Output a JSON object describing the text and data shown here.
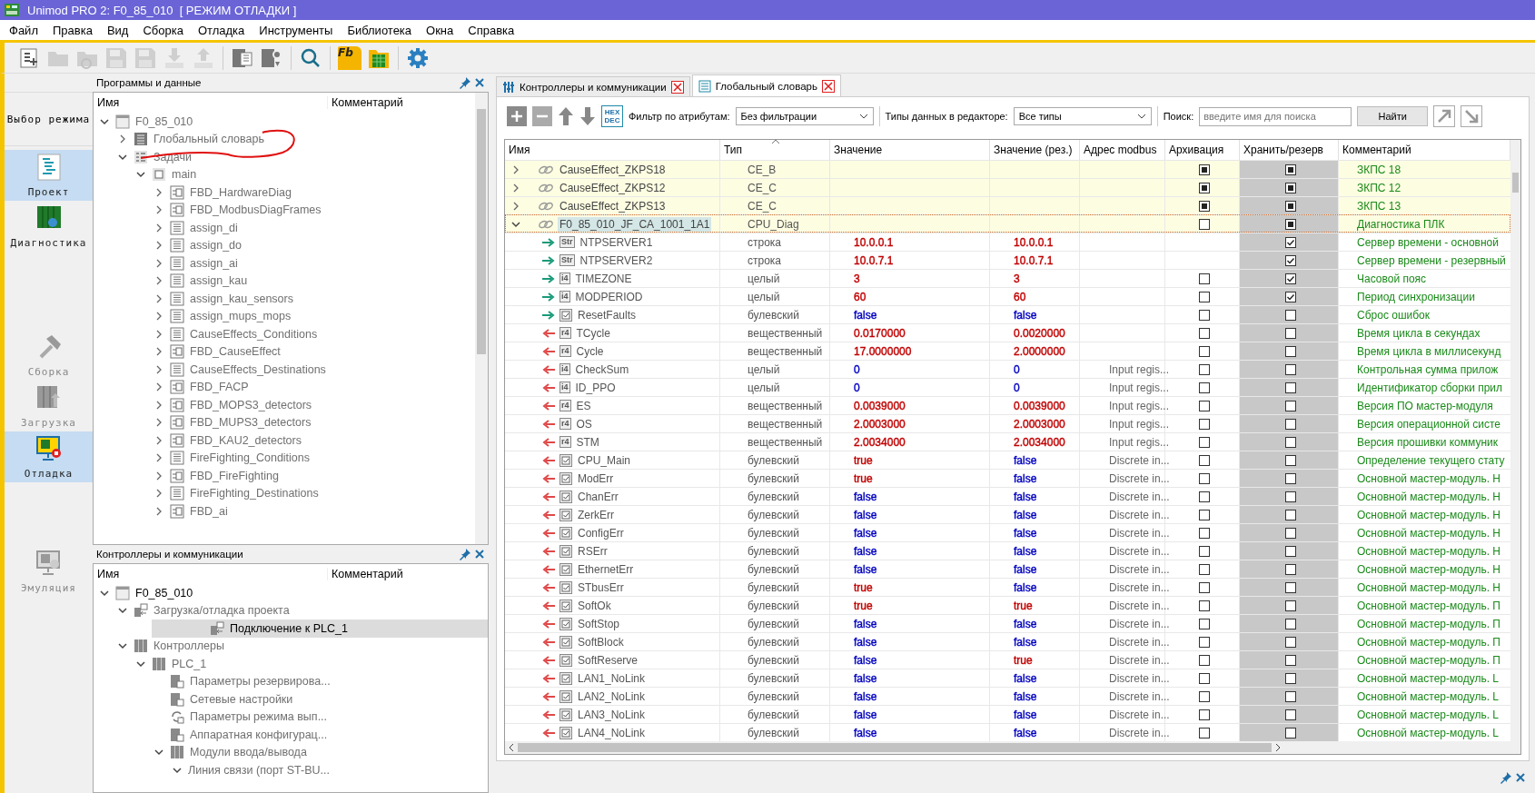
{
  "window": {
    "title": "Unimod PRO 2: F0_85_010  [ РЕЖИМ ОТЛАДКИ ]"
  },
  "menu": [
    "Файл",
    "Правка",
    "Вид",
    "Сборка",
    "Отладка",
    "Инструменты",
    "Библиотека",
    "Окна",
    "Справка"
  ],
  "toolbar": [
    {
      "kind": "new",
      "disabled": false
    },
    {
      "kind": "open",
      "disabled": true
    },
    {
      "kind": "reload",
      "disabled": true
    },
    {
      "kind": "save",
      "disabled": true
    },
    {
      "kind": "save",
      "disabled": true
    },
    {
      "kind": "download",
      "disabled": true
    },
    {
      "kind": "upload",
      "disabled": true
    },
    {
      "kind": "doc",
      "disabled": false
    },
    {
      "kind": "docgear",
      "disabled": false
    },
    {
      "kind": "search",
      "disabled": false
    },
    {
      "kind": "fb",
      "label": "Fb",
      "disabled": false
    },
    {
      "kind": "table",
      "disabled": false
    },
    {
      "kind": "gear",
      "disabled": false
    }
  ],
  "modes": {
    "header": "Выбор режима",
    "items": [
      {
        "kind": "project",
        "label": "Проект",
        "selected": true,
        "disabled": false
      },
      {
        "kind": "diagnostics",
        "label": "Диагностика",
        "selected": false,
        "disabled": false
      },
      {
        "kind": "build",
        "label": "Сборка",
        "selected": false,
        "disabled": true
      },
      {
        "kind": "load",
        "label": "Загрузка",
        "selected": false,
        "disabled": true
      },
      {
        "kind": "debug",
        "label": "Отладка",
        "selected": true,
        "disabled": false
      },
      {
        "kind": "emulation",
        "label": "Эмуляция",
        "selected": false,
        "disabled": true
      }
    ]
  },
  "programs_pane": {
    "title": "Программы и данные",
    "columns": [
      "Имя",
      "Комментарий"
    ],
    "tree": [
      {
        "label": "F0_85_010",
        "kind": "project",
        "expanded": true,
        "dimmed": true,
        "selected": false,
        "children": [
          {
            "label": "Глобальный словарь",
            "kind": "dictionary",
            "expanded": false,
            "dimmed": true,
            "selected": false
          },
          {
            "label": "Задачи",
            "kind": "tasks",
            "expanded": true,
            "dimmed": true,
            "selected": false,
            "children": [
              {
                "label": "main",
                "kind": "task",
                "expanded": true,
                "dimmed": true,
                "selected": false,
                "children": [
                  {
                    "label": "FBD_HardwareDiag",
                    "kind": "fbd",
                    "expanded": false,
                    "dimmed": true,
                    "selected": false
                  },
                  {
                    "label": "FBD_ModbusDiagFrames",
                    "kind": "fbd",
                    "expanded": false,
                    "dimmed": true,
                    "selected": false
                  },
                  {
                    "label": "assign_di",
                    "kind": "st",
                    "expanded": false,
                    "dimmed": true,
                    "selected": false
                  },
                  {
                    "label": "assign_do",
                    "kind": "st",
                    "expanded": false,
                    "dimmed": true,
                    "selected": false
                  },
                  {
                    "label": "assign_ai",
                    "kind": "st",
                    "expanded": false,
                    "dimmed": true,
                    "selected": false
                  },
                  {
                    "label": "assign_kau",
                    "kind": "st",
                    "expanded": false,
                    "dimmed": true,
                    "selected": false
                  },
                  {
                    "label": "assign_kau_sensors",
                    "kind": "st",
                    "expanded": false,
                    "dimmed": true,
                    "selected": false
                  },
                  {
                    "label": "assign_mups_mops",
                    "kind": "st",
                    "expanded": false,
                    "dimmed": true,
                    "selected": false
                  },
                  {
                    "label": "CauseEffects_Conditions",
                    "kind": "st",
                    "expanded": false,
                    "dimmed": true,
                    "selected": false
                  },
                  {
                    "label": "FBD_CauseEffect",
                    "kind": "fbd",
                    "expanded": false,
                    "dimmed": true,
                    "selected": false
                  },
                  {
                    "label": "CauseEffects_Destinations",
                    "kind": "st",
                    "expanded": false,
                    "dimmed": true,
                    "selected": false
                  },
                  {
                    "label": "FBD_FACP",
                    "kind": "fbd",
                    "expanded": false,
                    "dimmed": true,
                    "selected": false
                  },
                  {
                    "label": "FBD_MOPS3_detectors",
                    "kind": "fbd",
                    "expanded": false,
                    "dimmed": true,
                    "selected": false
                  },
                  {
                    "label": "FBD_MUPS3_detectors",
                    "kind": "fbd",
                    "expanded": false,
                    "dimmed": true,
                    "selected": false
                  },
                  {
                    "label": "FBD_KAU2_detectors",
                    "kind": "fbd",
                    "expanded": false,
                    "dimmed": true,
                    "selected": false
                  },
                  {
                    "label": "FireFighting_Conditions",
                    "kind": "st",
                    "expanded": false,
                    "dimmed": true,
                    "selected": false
                  },
                  {
                    "label": "FBD_FireFighting",
                    "kind": "fbd",
                    "expanded": false,
                    "dimmed": true,
                    "selected": false
                  },
                  {
                    "label": "FireFighting_Destinations",
                    "kind": "st",
                    "expanded": false,
                    "dimmed": true,
                    "selected": false
                  },
                  {
                    "label": "FBD_ai",
                    "kind": "fbd",
                    "expanded": false,
                    "dimmed": true,
                    "selected": false
                  }
                ]
              }
            ]
          }
        ]
      }
    ]
  },
  "controllers_pane": {
    "title": "Контроллеры и коммуникации",
    "columns": [
      "Имя",
      "Комментарий"
    ],
    "tree": [
      {
        "label": "F0_85_010",
        "kind": "project",
        "expanded": true,
        "dimmed": false,
        "selected": false,
        "children": [
          {
            "label": "Загрузка/отладка проекта",
            "kind": "connection",
            "expanded": true,
            "dimmed": true,
            "selected": false,
            "children": [
              {
                "label": "Подключение к PLC_1",
                "kind": "connection",
                "dimmed": false,
                "selected": true
              }
            ]
          },
          {
            "label": "Контроллеры",
            "kind": "rack",
            "expanded": true,
            "dimmed": true,
            "selected": false,
            "children": [
              {
                "label": "PLC_1",
                "kind": "rack",
                "expanded": true,
                "dimmed": true,
                "selected": false,
                "children": [
                  {
                    "label": "Параметры резервирова...",
                    "kind": "settings",
                    "dimmed": true,
                    "selected": false
                  },
                  {
                    "label": "Сетевые настройки",
                    "kind": "settings",
                    "dimmed": true,
                    "selected": false
                  },
                  {
                    "label": "Параметры режима вып...",
                    "kind": "cycle",
                    "dimmed": true,
                    "selected": false
                  },
                  {
                    "label": "Аппаратная конфигурац...",
                    "kind": "settings",
                    "dimmed": true,
                    "selected": false
                  },
                  {
                    "label": "Модули ввода/вывода",
                    "kind": "rack",
                    "expanded": true,
                    "dimmed": true,
                    "selected": false,
                    "children": [
                      {
                        "label": "Линия связи (порт ST-BU...",
                        "expanded": true,
                        "dimmed": true,
                        "selected": false
                      }
                    ]
                  }
                ]
              }
            ]
          }
        ]
      }
    ]
  },
  "editor_tabs": [
    {
      "label": "Контроллеры и коммуникации",
      "kind": "controllers",
      "selected": false
    },
    {
      "label": "Глобальный словарь",
      "kind": "dictionary",
      "selected": true
    }
  ],
  "editor_toolbar": {
    "hex_dec": [
      "HEX",
      "DEC"
    ],
    "filter_label": "Фильтр по атрибутам:",
    "filter_value": "Без фильтрации",
    "types_label": "Типы данных в редакторе:",
    "types_value": "Все типы",
    "search_label": "Поиск:",
    "search_placeholder": "введите имя для поиска",
    "find_button": "Найти"
  },
  "table": {
    "columns": [
      "Имя",
      "Тип",
      "Значение",
      "Значение (рез.)",
      "Адрес modbus",
      "Архивация",
      "Хранить/резерв",
      "Комментарий"
    ],
    "rows": [
      {
        "kind": "group",
        "expanded": false,
        "selected": false,
        "name": "CauseEffect_ZKPS18",
        "type": "CE_B",
        "archive": true,
        "keep": true,
        "comment": "ЗКПС 18"
      },
      {
        "kind": "group",
        "expanded": false,
        "selected": false,
        "name": "CauseEffect_ZKPS12",
        "type": "CE_C",
        "archive": true,
        "keep": true,
        "comment": "ЗКПС 12"
      },
      {
        "kind": "group",
        "expanded": false,
        "selected": false,
        "name": "CauseEffect_ZKPS13",
        "type": "CE_C",
        "archive": true,
        "keep": true,
        "comment": "ЗКПС 13"
      },
      {
        "kind": "group",
        "expanded": true,
        "selected": true,
        "name": "F0_85_010_JF_CA_1001_1A1",
        "type": "CPU_Diag",
        "archive": false,
        "keep": true,
        "comment": "Диагностика ПЛК"
      },
      {
        "kind": "field",
        "selected": false,
        "output": false,
        "badge": "Str",
        "name": "NTPSERVER1",
        "type": "строка",
        "value": {
          "text": "10.0.0.1",
          "color": "#c00000"
        },
        "reserve": {
          "text": "10.0.0.1",
          "color": "#c00000"
        },
        "keep": true,
        "comment": "Сервер времени - основной"
      },
      {
        "kind": "field",
        "selected": false,
        "output": false,
        "badge": "Str",
        "name": "NTPSERVER2",
        "type": "строка",
        "value": {
          "text": "10.0.7.1",
          "color": "#c00000"
        },
        "reserve": {
          "text": "10.0.7.1",
          "color": "#c00000"
        },
        "keep": true,
        "comment": "Сервер времени - резервный"
      },
      {
        "kind": "field",
        "selected": false,
        "output": false,
        "badge": "i4",
        "name": "TIMEZONE",
        "type": "целый",
        "value": {
          "text": "3",
          "color": "#c00000"
        },
        "reserve": {
          "text": "3",
          "color": "#c00000"
        },
        "archive": false,
        "keep": true,
        "comment": "Часовой пояс"
      },
      {
        "kind": "field",
        "selected": false,
        "output": false,
        "badge": "i4",
        "name": "MODPERIOD",
        "type": "целый",
        "value": {
          "text": "60",
          "color": "#c00000"
        },
        "reserve": {
          "text": "60",
          "color": "#c00000"
        },
        "archive": false,
        "keep": true,
        "comment": "Период синхронизации"
      },
      {
        "kind": "field",
        "selected": false,
        "output": false,
        "name": "ResetFaults",
        "type": "булевский",
        "value": {
          "text": "false",
          "color": "#0000c0"
        },
        "reserve": {
          "text": "false",
          "color": "#0000c0"
        },
        "archive": false,
        "keep": false,
        "comment": "Сброс ошибок"
      },
      {
        "kind": "field",
        "selected": false,
        "output": true,
        "badge": "r4",
        "name": "TCycle",
        "type": "вещественный",
        "value": {
          "text": "0.0170000",
          "color": "#c00000"
        },
        "reserve": {
          "text": "0.0020000",
          "color": "#c00000"
        },
        "archive": false,
        "keep": false,
        "comment": "Время цикла в секундах"
      },
      {
        "kind": "field",
        "selected": false,
        "output": true,
        "badge": "r4",
        "name": "Cycle",
        "type": "вещественный",
        "value": {
          "text": "17.0000000",
          "color": "#c00000"
        },
        "reserve": {
          "text": "2.0000000",
          "color": "#c00000"
        },
        "archive": false,
        "keep": false,
        "comment": "Время цикла в миллисекунд"
      },
      {
        "kind": "field",
        "selected": false,
        "output": true,
        "badge": "i4",
        "name": "CheckSum",
        "type": "целый",
        "value": {
          "text": "0",
          "color": "#0000c0"
        },
        "reserve": {
          "text": "0",
          "color": "#0000c0"
        },
        "modbus": "Input regis...",
        "archive": false,
        "keep": false,
        "comment": "Контрольная сумма прилож"
      },
      {
        "kind": "field",
        "selected": false,
        "output": true,
        "badge": "i4",
        "name": "ID_PPO",
        "type": "целый",
        "value": {
          "text": "0",
          "color": "#0000c0"
        },
        "reserve": {
          "text": "0",
          "color": "#0000c0"
        },
        "modbus": "Input regis...",
        "archive": false,
        "keep": false,
        "comment": "Идентификатор сборки прил"
      },
      {
        "kind": "field",
        "selected": false,
        "output": true,
        "badge": "r4",
        "name": "ES",
        "type": "вещественный",
        "value": {
          "text": "0.0039000",
          "color": "#c00000"
        },
        "reserve": {
          "text": "0.0039000",
          "color": "#c00000"
        },
        "modbus": "Input regis...",
        "archive": false,
        "keep": false,
        "comment": "Версия ПО мастер-модуля"
      },
      {
        "kind": "field",
        "selected": false,
        "output": true,
        "badge": "r4",
        "name": "OS",
        "type": "вещественный",
        "value": {
          "text": "2.0003000",
          "color": "#c00000"
        },
        "reserve": {
          "text": "2.0003000",
          "color": "#c00000"
        },
        "modbus": "Input regis...",
        "archive": false,
        "keep": false,
        "comment": "Версия операционной систе"
      },
      {
        "kind": "field",
        "selected": false,
        "output": true,
        "badge": "r4",
        "name": "STM",
        "type": "вещественный",
        "value": {
          "text": "2.0034000",
          "color": "#c00000"
        },
        "reserve": {
          "text": "2.0034000",
          "color": "#c00000"
        },
        "modbus": "Input regis...",
        "archive": false,
        "keep": false,
        "comment": "Версия прошивки коммуник"
      },
      {
        "kind": "field",
        "selected": false,
        "output": true,
        "name": "CPU_Main",
        "type": "булевский",
        "value": {
          "text": "true",
          "color": "#c00000"
        },
        "reserve": {
          "text": "false",
          "color": "#0000c0"
        },
        "modbus": "Discrete in...",
        "archive": false,
        "keep": false,
        "comment": "Определение текущего стату"
      },
      {
        "kind": "field",
        "selected": false,
        "output": true,
        "name": "ModErr",
        "type": "булевский",
        "value": {
          "text": "true",
          "color": "#c00000"
        },
        "reserve": {
          "text": "false",
          "color": "#0000c0"
        },
        "modbus": "Discrete in...",
        "archive": false,
        "keep": false,
        "comment": "Основной мастер-модуль. Н"
      },
      {
        "kind": "field",
        "selected": false,
        "output": true,
        "name": "ChanErr",
        "type": "булевский",
        "value": {
          "text": "false",
          "color": "#0000c0"
        },
        "reserve": {
          "text": "false",
          "color": "#0000c0"
        },
        "modbus": "Discrete in...",
        "archive": false,
        "keep": false,
        "comment": "Основной мастер-модуль. Н"
      },
      {
        "kind": "field",
        "selected": false,
        "output": true,
        "name": "ZerkErr",
        "type": "булевский",
        "value": {
          "text": "false",
          "color": "#0000c0"
        },
        "reserve": {
          "text": "false",
          "color": "#0000c0"
        },
        "modbus": "Discrete in...",
        "archive": false,
        "keep": false,
        "comment": "Основной мастер-модуль. Н"
      },
      {
        "kind": "field",
        "selected": false,
        "output": true,
        "name": "ConfigErr",
        "type": "булевский",
        "value": {
          "text": "false",
          "color": "#0000c0"
        },
        "reserve": {
          "text": "false",
          "color": "#0000c0"
        },
        "modbus": "Discrete in...",
        "archive": false,
        "keep": false,
        "comment": "Основной мастер-модуль. Н"
      },
      {
        "kind": "field",
        "selected": false,
        "output": true,
        "name": "RSErr",
        "type": "булевский",
        "value": {
          "text": "false",
          "color": "#0000c0"
        },
        "reserve": {
          "text": "false",
          "color": "#0000c0"
        },
        "modbus": "Discrete in...",
        "archive": false,
        "keep": false,
        "comment": "Основной мастер-модуль. Н"
      },
      {
        "kind": "field",
        "selected": false,
        "output": true,
        "name": "EthernetErr",
        "type": "булевский",
        "value": {
          "text": "false",
          "color": "#0000c0"
        },
        "reserve": {
          "text": "false",
          "color": "#0000c0"
        },
        "modbus": "Discrete in...",
        "archive": false,
        "keep": false,
        "comment": "Основной мастер-модуль. Н"
      },
      {
        "kind": "field",
        "selected": false,
        "output": true,
        "name": "STbusErr",
        "type": "булевский",
        "value": {
          "text": "true",
          "color": "#c00000"
        },
        "reserve": {
          "text": "false",
          "color": "#0000c0"
        },
        "modbus": "Discrete in...",
        "archive": false,
        "keep": false,
        "comment": "Основной мастер-модуль. Н"
      },
      {
        "kind": "field",
        "selected": false,
        "output": true,
        "name": "SoftOk",
        "type": "булевский",
        "value": {
          "text": "true",
          "color": "#c00000"
        },
        "reserve": {
          "text": "true",
          "color": "#c00000"
        },
        "modbus": "Discrete in...",
        "archive": false,
        "keep": false,
        "comment": "Основной мастер-модуль. П"
      },
      {
        "kind": "field",
        "selected": false,
        "output": true,
        "name": "SoftStop",
        "type": "булевский",
        "value": {
          "text": "false",
          "color": "#0000c0"
        },
        "reserve": {
          "text": "false",
          "color": "#0000c0"
        },
        "modbus": "Discrete in...",
        "archive": false,
        "keep": false,
        "comment": "Основной мастер-модуль. П"
      },
      {
        "kind": "field",
        "selected": false,
        "output": true,
        "name": "SoftBlock",
        "type": "булевский",
        "value": {
          "text": "false",
          "color": "#0000c0"
        },
        "reserve": {
          "text": "false",
          "color": "#0000c0"
        },
        "modbus": "Discrete in...",
        "archive": false,
        "keep": false,
        "comment": "Основной мастер-модуль. П"
      },
      {
        "kind": "field",
        "selected": false,
        "output": true,
        "name": "SoftReserve",
        "type": "булевский",
        "value": {
          "text": "false",
          "color": "#0000c0"
        },
        "reserve": {
          "text": "true",
          "color": "#c00000"
        },
        "modbus": "Discrete in...",
        "archive": false,
        "keep": false,
        "comment": "Основной мастер-модуль. П"
      },
      {
        "kind": "field",
        "selected": false,
        "output": true,
        "name": "LAN1_NoLink",
        "type": "булевский",
        "value": {
          "text": "false",
          "color": "#0000c0"
        },
        "reserve": {
          "text": "false",
          "color": "#0000c0"
        },
        "modbus": "Discrete in...",
        "archive": false,
        "keep": false,
        "comment": "Основной мастер-модуль. L"
      },
      {
        "kind": "field",
        "selected": false,
        "output": true,
        "name": "LAN2_NoLink",
        "type": "булевский",
        "value": {
          "text": "false",
          "color": "#0000c0"
        },
        "reserve": {
          "text": "false",
          "color": "#0000c0"
        },
        "modbus": "Discrete in...",
        "archive": false,
        "keep": false,
        "comment": "Основной мастер-модуль. L"
      },
      {
        "kind": "field",
        "selected": false,
        "output": true,
        "name": "LAN3_NoLink",
        "type": "булевский",
        "value": {
          "text": "false",
          "color": "#0000c0"
        },
        "reserve": {
          "text": "false",
          "color": "#0000c0"
        },
        "modbus": "Discrete in...",
        "archive": false,
        "keep": false,
        "comment": "Основной мастер-модуль. L"
      },
      {
        "kind": "field",
        "selected": false,
        "output": true,
        "name": "LAN4_NoLink",
        "type": "булевский",
        "value": {
          "text": "false",
          "color": "#0000c0"
        },
        "reserve": {
          "text": "false",
          "color": "#0000c0"
        },
        "modbus": "Discrete in...",
        "archive": false,
        "keep": false,
        "comment": "Основной мастер-модуль. L"
      }
    ]
  }
}
